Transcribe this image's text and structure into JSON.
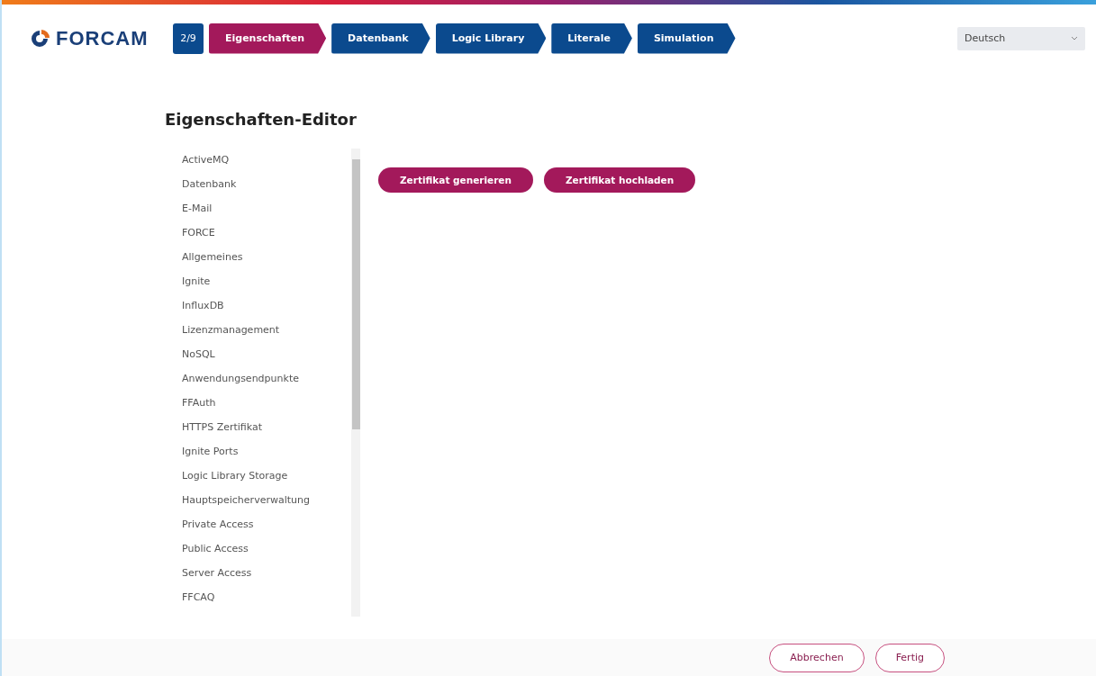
{
  "header": {
    "logo": "FORCAM",
    "step_counter": "2/9",
    "steps": [
      {
        "label": "Eigenschaften",
        "selected": true
      },
      {
        "label": "Datenbank",
        "selected": false
      },
      {
        "label": "Logic Library",
        "selected": false
      },
      {
        "label": "Literale",
        "selected": false
      },
      {
        "label": "Simulation",
        "selected": false
      }
    ],
    "language": {
      "value": "Deutsch"
    }
  },
  "editor": {
    "title": "Eigenschaften-Editor",
    "categories": [
      "ActiveMQ",
      "Datenbank",
      "E-Mail",
      "FORCE",
      "Allgemeines",
      "Ignite",
      "InfluxDB",
      "Lizenzmanagement",
      "NoSQL",
      "Anwendungsendpunkte",
      "FFAuth",
      "HTTPS Zertifikat",
      "Ignite Ports",
      "Logic Library Storage",
      "Hauptspeicherverwaltung",
      "Private Access",
      "Public Access",
      "Server Access",
      "FFCAQ"
    ],
    "actions": [
      "Zertifikat generieren",
      "Zertifikat hochladen"
    ]
  },
  "footer": {
    "buttons": [
      "Abbrechen",
      "Fertig"
    ]
  }
}
